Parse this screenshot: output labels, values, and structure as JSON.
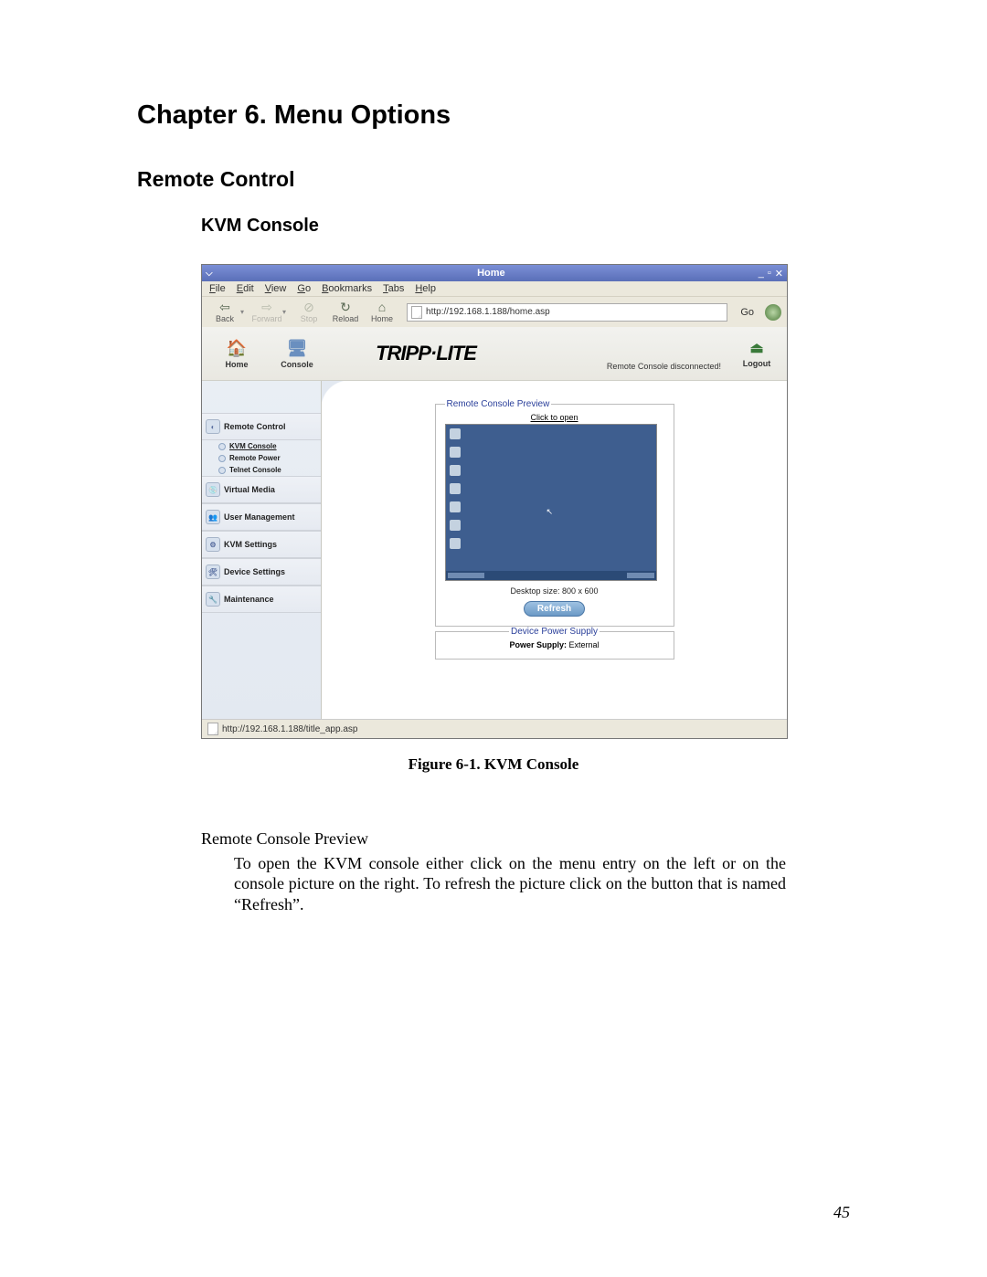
{
  "chapter_title": "Chapter 6. Menu Options",
  "section_title": "Remote Control",
  "subsection_title": "KVM Console",
  "browser": {
    "window_title": "Home",
    "window_controls": {
      "minimize": "_",
      "maximize": "▫",
      "close": "✕"
    },
    "menubar": [
      "File",
      "Edit",
      "View",
      "Go",
      "Bookmarks",
      "Tabs",
      "Help"
    ],
    "toolbar": {
      "back": "Back",
      "forward": "Forward",
      "stop": "Stop",
      "reload": "Reload",
      "home": "Home",
      "go": "Go"
    },
    "url": "http://192.168.1.188/home.asp",
    "status_url": "http://192.168.1.188/title_app.asp"
  },
  "app": {
    "header": {
      "home": "Home",
      "console": "Console",
      "brand": "TRIPP·LITE",
      "status": "Remote Console disconnected!",
      "logout": "Logout"
    },
    "sidebar": {
      "remote_control": "Remote Control",
      "subitems": {
        "kvm_console": "KVM Console",
        "remote_power": "Remote Power",
        "telnet_console": "Telnet Console"
      },
      "virtual_media": "Virtual Media",
      "user_management": "User Management",
      "kvm_settings": "KVM Settings",
      "device_settings": "Device Settings",
      "maintenance": "Maintenance"
    },
    "content": {
      "preview_legend": "Remote Console Preview",
      "click_to_open": "Click to open",
      "desktop_size": "Desktop size: 800 x 600",
      "refresh": "Refresh",
      "power_legend": "Device Power Supply",
      "power_label": "Power Supply:",
      "power_value": "External"
    }
  },
  "figure_caption": "Figure 6-1. KVM Console",
  "body": {
    "para_title": "Remote Console Preview",
    "para_body": "To open the KVM console either click on the menu entry on the left or on the console picture on the right. To refresh the picture click on the button that is named “Refresh”."
  },
  "page_number": "45"
}
